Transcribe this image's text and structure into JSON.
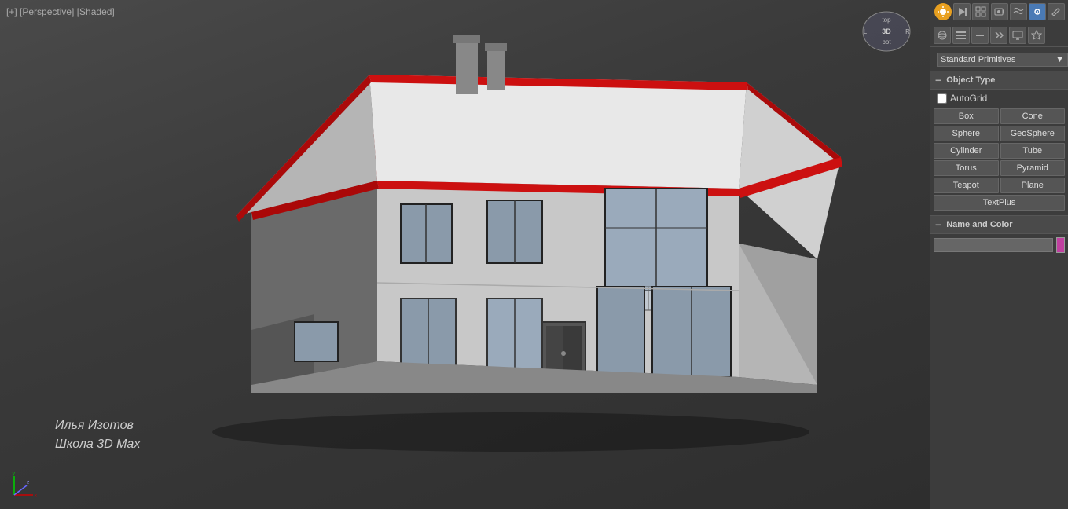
{
  "viewport": {
    "label": "[+] [Perspective] [Shaded]"
  },
  "watermark": {
    "line1": "Илья Изотов",
    "line2": "Школа 3D Max"
  },
  "right_panel": {
    "dropdown_label": "Standard Primitives",
    "sections": {
      "object_type": {
        "header": "Object Type",
        "autogrid_label": "AutoGrid",
        "buttons": [
          "Box",
          "Cone",
          "Sphere",
          "GeoSphere",
          "Cylinder",
          "Tube",
          "Torus",
          "Pyramid",
          "Teapot",
          "Plane",
          "TextPlus"
        ]
      },
      "name_and_color": {
        "header": "Name and Color",
        "input_value": "",
        "input_placeholder": ""
      }
    }
  },
  "toolbar": {
    "icons": [
      "☀",
      "◐",
      "⊞",
      "⊡",
      "≋",
      "✦",
      "⚙",
      "✏"
    ],
    "second_row": [
      "◉",
      "☰",
      "⊟",
      "⌂",
      "≈",
      "~"
    ]
  }
}
